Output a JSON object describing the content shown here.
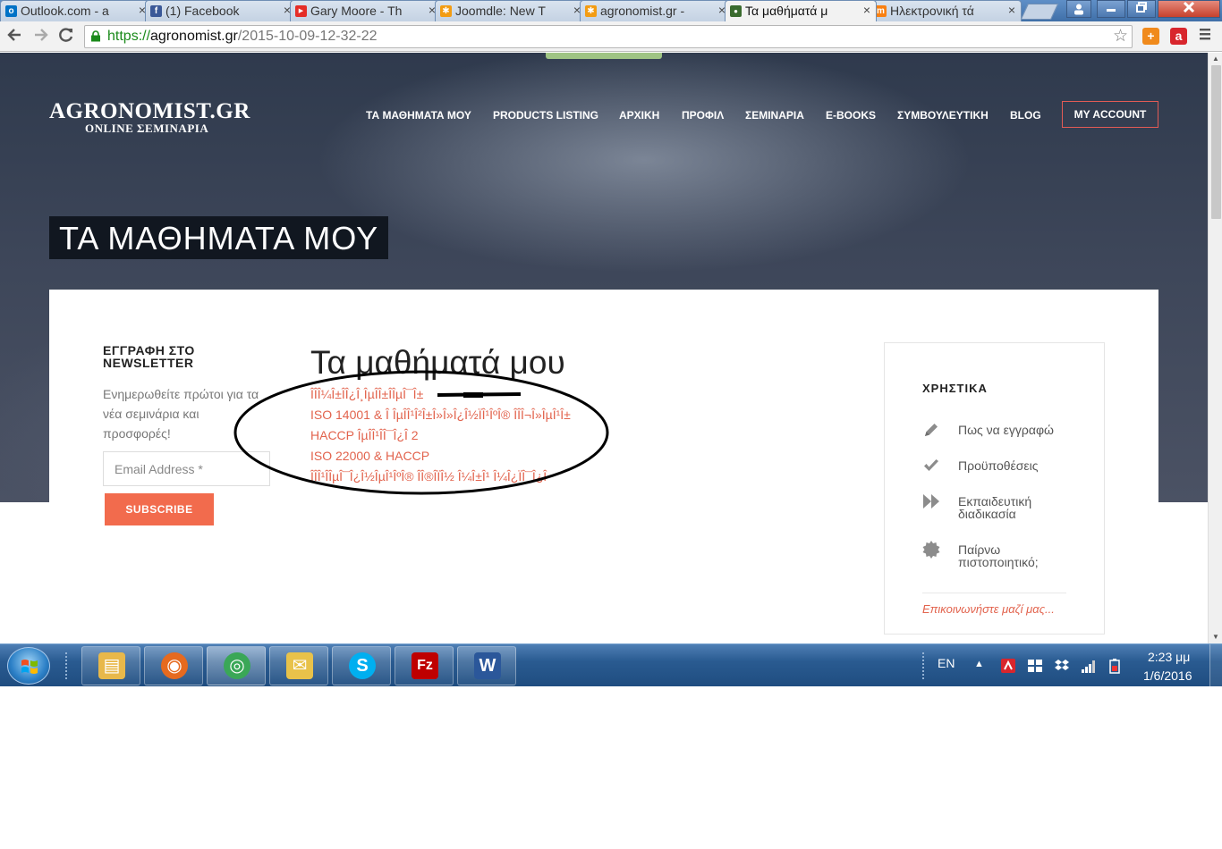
{
  "browser": {
    "tabs": [
      {
        "title": "Outlook.com - a",
        "favicon": "outlook-icon",
        "color": "#0072c6",
        "glyph": "o"
      },
      {
        "title": "(1) Facebook",
        "favicon": "facebook-icon",
        "color": "#3b5998",
        "glyph": "f"
      },
      {
        "title": "Gary Moore - Th",
        "favicon": "youtube-icon",
        "color": "#e52d27",
        "glyph": "▶"
      },
      {
        "title": "Joomdle: New T",
        "favicon": "joomdle-icon",
        "color": "#f39c12",
        "glyph": "✱"
      },
      {
        "title": "agronomist.gr -",
        "favicon": "joomdle-icon",
        "color": "#f39c12",
        "glyph": "✱"
      },
      {
        "title": "Τα μαθήματά μ",
        "favicon": "agronomist-icon",
        "color": "#3a6b2e",
        "glyph": "●"
      },
      {
        "title": "Ηλεκτρονική τά",
        "favicon": "moodle-icon",
        "color": "#f98012",
        "glyph": "m"
      }
    ],
    "url_scheme": "https://",
    "url_host": "agronomist.gr",
    "url_path": "/2015-10-09-12-32-22",
    "close_glyph": "×"
  },
  "site": {
    "logo_main": "AGRONOMIST.GR",
    "logo_sub": "ONLINE ΣΕΜΙΝΑΡΙΑ",
    "nav": [
      "ΤΑ ΜΑΘΗΜΑΤΑ ΜΟΥ",
      "PRODUCTS LISTING",
      "ΑΡΧΙΚΗ",
      "ΠΡΟΦΙΛ",
      "ΣΕΜΙΝΑΡΙΑ",
      "E-BOOKS",
      "ΣΥΜΒΟΥΛΕΥΤΙΚΗ",
      "BLOG"
    ],
    "account_label": "MY ACCOUNT",
    "page_heading": "ΤΑ ΜΑΘΗΜΑΤΑ ΜΟΥ"
  },
  "newsletter": {
    "title": "ΕΓΓΡΑΦΗ ΣΤΟ NEWSLETTER",
    "description": "Ενημερωθείτε πρώτοι για τα νέα σεμινάρια και προσφορές!",
    "email_placeholder": "Email Address *",
    "subscribe_label": "SUBSCRIBE"
  },
  "courses": {
    "title": "Τα μαθήματά μου",
    "items": [
      "ÎÎÎ¼Î±ÎÎ¿Î¸ÎµÎÎ±ÎÎµÎ¯Î±",
      "ISO 14001 & Î ÎµÎÎ¹Î²Î±Î»Î»Î¿Î½ÏÎ¹ÎºÎ® ÎÎÎ¬Î»ÎµÎ¹Î±",
      "HACCP ÎµÎÎ¹ÎÎ¯Î¿Î 2",
      "ISO 22000 & HACCP",
      "ÎÎÎ¹ÎÎµÎ¯Î¿Î½ÎµÎ¹ÎºÎ® ÎÎ®ÎÏÎ½ Î¼Î±Î¹ Î¼Î¿ÏÎ¯Î¿Î"
    ]
  },
  "sidebar": {
    "title": "ΧΡΗΣΤΙΚΑ",
    "items": [
      {
        "label": "Πως να εγγραφώ",
        "icon": "pencil-icon"
      },
      {
        "label": "Προϋποθέσεις",
        "icon": "checkmark-icon"
      },
      {
        "label": "Εκπαιδευτική διαδικασία",
        "icon": "fast-forward-icon"
      },
      {
        "label": "Παίρνω πιστοποιητικό;",
        "icon": "badge-icon"
      }
    ],
    "contact_link": "Επικοινωνήστε μαζί μας..."
  },
  "taskbar": {
    "apps": [
      {
        "name": "explorer-icon",
        "color": "#e8b84a",
        "glyph": "▤"
      },
      {
        "name": "firefox-icon",
        "color": "#e66a1f",
        "glyph": "◉"
      },
      {
        "name": "chrome-icon",
        "color": "#3aa757",
        "glyph": "◎"
      },
      {
        "name": "outlook-express-icon",
        "color": "#e8c24a",
        "glyph": "✉"
      },
      {
        "name": "skype-icon",
        "color": "#00aff0",
        "glyph": "S"
      },
      {
        "name": "filezilla-icon",
        "color": "#bf0000",
        "glyph": "Fz"
      },
      {
        "name": "word-icon",
        "color": "#2b579a",
        "glyph": "W"
      }
    ],
    "language": "EN",
    "time": "2:23 μμ",
    "date": "1/6/2016"
  },
  "colors": {
    "accent": "#f26b4d",
    "link": "#e2634d",
    "hero_dark": "#2f3a4d"
  }
}
